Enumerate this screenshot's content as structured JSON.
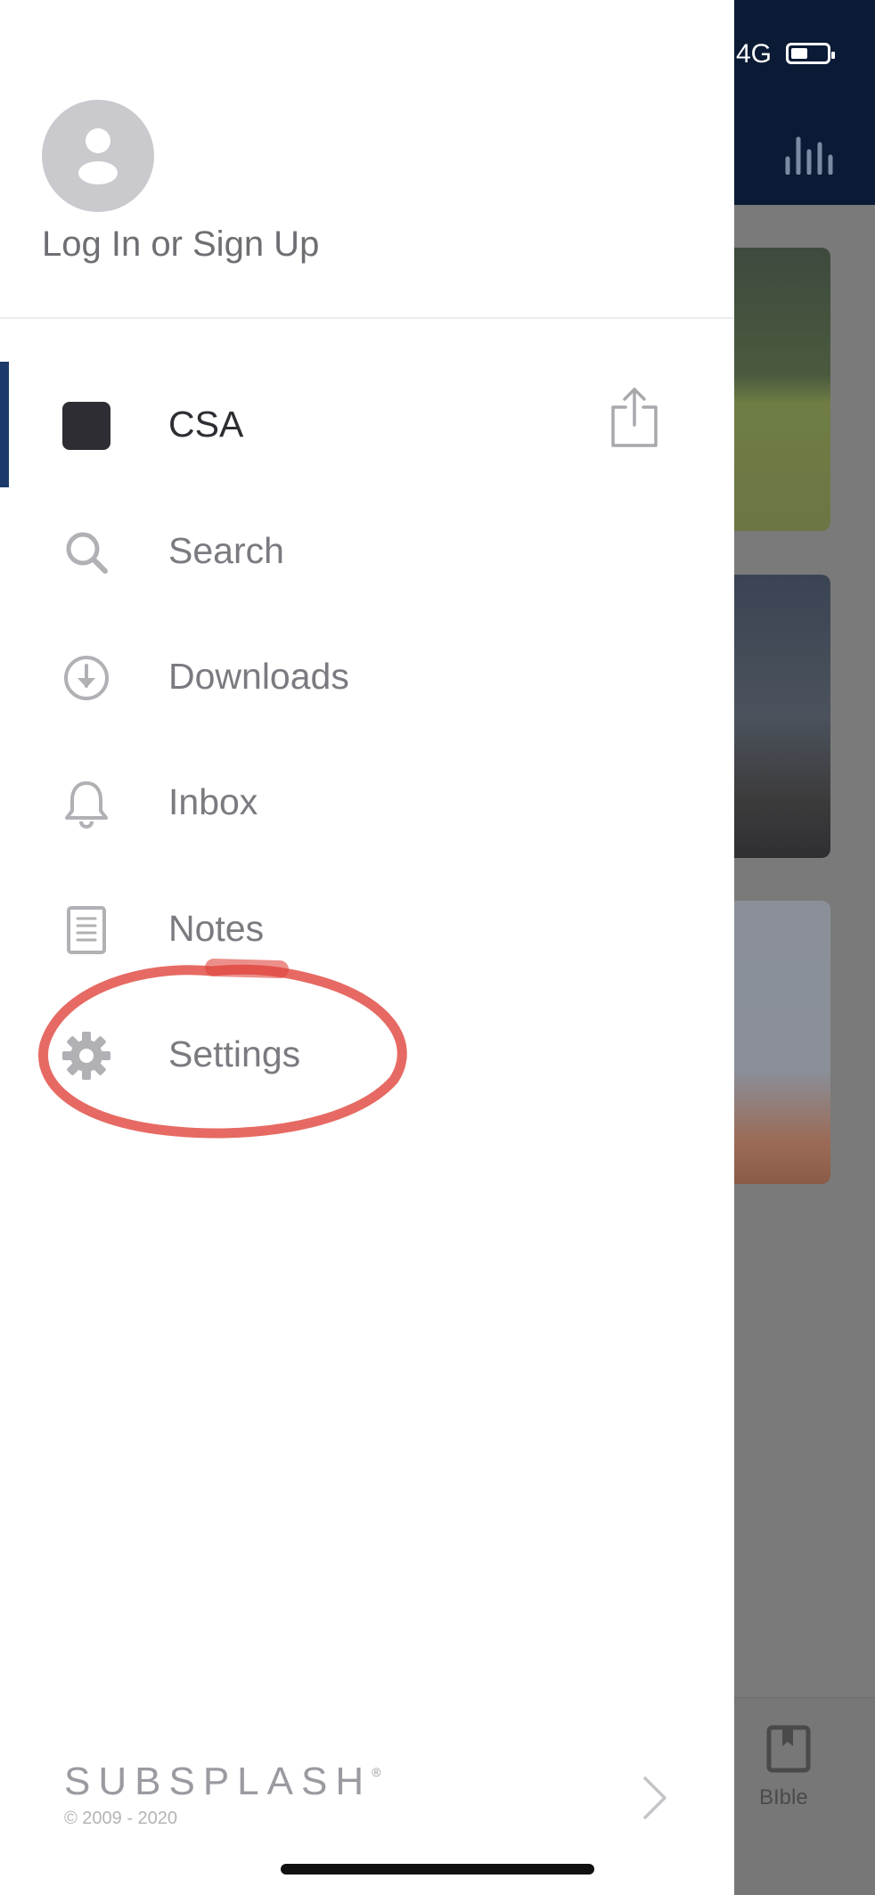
{
  "status_bar": {
    "network": "4G"
  },
  "drawer": {
    "login_label": "Log In or Sign Up",
    "menu": [
      {
        "label": "CSA",
        "icon": "app-icon",
        "active": true
      },
      {
        "label": "Search",
        "icon": "search-icon"
      },
      {
        "label": "Downloads",
        "icon": "download-icon"
      },
      {
        "label": "Inbox",
        "icon": "bell-icon"
      },
      {
        "label": "Notes",
        "icon": "notes-icon"
      },
      {
        "label": "Settings",
        "icon": "gear-icon"
      }
    ],
    "footer": {
      "brand": "SUBSPLASH",
      "brand_mark": "®",
      "copyright": "© 2009 - 2020"
    }
  },
  "background_app": {
    "tab_bible": "BIble"
  },
  "colors": {
    "accent": "#1b3a6b",
    "annotation": "#e0453c",
    "header": "#0b1b36"
  }
}
